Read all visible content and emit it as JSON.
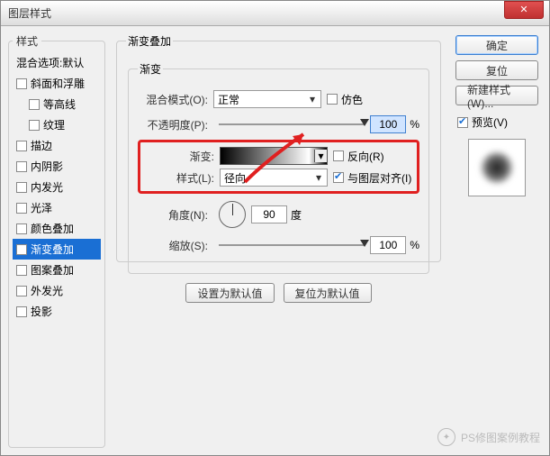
{
  "window": {
    "title": "图层样式"
  },
  "left": {
    "heading": "样式",
    "blend_opts": "混合选项:默认",
    "items": [
      {
        "label": "斜面和浮雕",
        "checked": false,
        "indent": false
      },
      {
        "label": "等高线",
        "checked": false,
        "indent": true
      },
      {
        "label": "纹理",
        "checked": false,
        "indent": true
      },
      {
        "label": "描边",
        "checked": false,
        "indent": false
      },
      {
        "label": "内阴影",
        "checked": false,
        "indent": false
      },
      {
        "label": "内发光",
        "checked": false,
        "indent": false
      },
      {
        "label": "光泽",
        "checked": false,
        "indent": false
      },
      {
        "label": "颜色叠加",
        "checked": false,
        "indent": false
      },
      {
        "label": "渐变叠加",
        "checked": true,
        "indent": false,
        "selected": true
      },
      {
        "label": "图案叠加",
        "checked": false,
        "indent": false
      },
      {
        "label": "外发光",
        "checked": false,
        "indent": false
      },
      {
        "label": "投影",
        "checked": false,
        "indent": false
      }
    ]
  },
  "main": {
    "title": "渐变叠加",
    "inner_title": "渐变",
    "blend_mode_label": "混合模式(O):",
    "blend_mode_value": "正常",
    "dither_label": "仿色",
    "opacity_label": "不透明度(P):",
    "opacity_value": "100",
    "opacity_unit": "%",
    "gradient_label": "渐变:",
    "reverse_label": "反向(R)",
    "style_label": "样式(L):",
    "style_value": "径向",
    "align_label": "与图层对齐(I)",
    "angle_label": "角度(N):",
    "angle_value": "90",
    "angle_unit": "度",
    "scale_label": "缩放(S):",
    "scale_value": "100",
    "scale_unit": "%",
    "set_default": "设置为默认值",
    "reset_default": "复位为默认值"
  },
  "right": {
    "ok": "确定",
    "cancel": "复位",
    "new_style": "新建样式(W)...",
    "preview_label": "预览(V)"
  },
  "watermark": "PS修图案例教程"
}
